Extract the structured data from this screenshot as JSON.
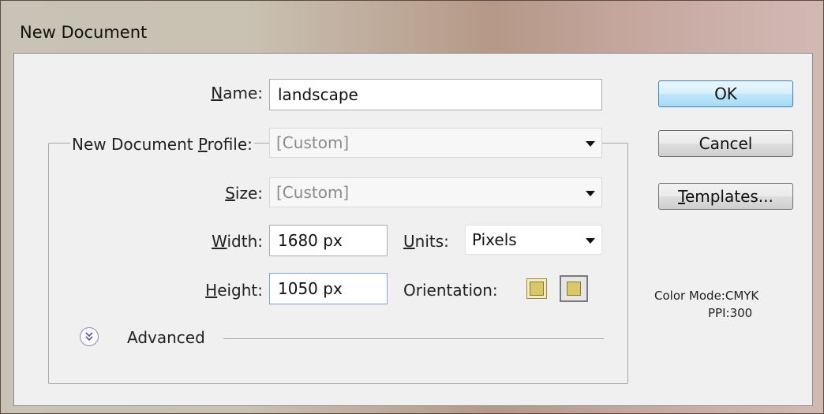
{
  "window": {
    "title": "New Document"
  },
  "form": {
    "name_label": "Name:",
    "name_value": "landscape",
    "profile_label": "New Document Profile:",
    "profile_value": "[Custom]",
    "size_label": "Size:",
    "size_value": "[Custom]",
    "width_label": "Width:",
    "width_value": "1680 px",
    "units_label": "Units:",
    "units_value": "Pixels",
    "height_label": "Height:",
    "height_value": "1050 px",
    "orientation_label": "Orientation:",
    "orientation_selected": "landscape",
    "advanced_label": "Advanced"
  },
  "buttons": {
    "ok": "OK",
    "cancel": "Cancel",
    "templates": "Templates..."
  },
  "info": {
    "color_mode": "Color Mode:CMYK",
    "ppi": "PPI:300"
  },
  "icons": {
    "dropdown": "chevron-down-icon",
    "portrait": "portrait-orientation-icon",
    "landscape": "landscape-orientation-icon",
    "advanced": "double-chevron-down-icon"
  }
}
